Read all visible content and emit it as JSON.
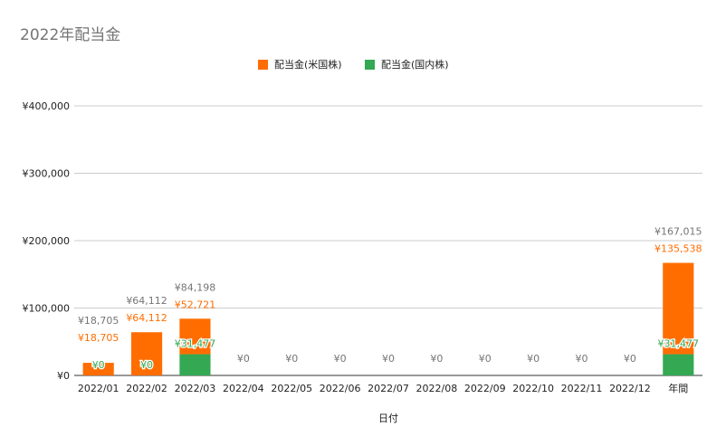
{
  "chart_data": {
    "type": "bar",
    "stacked": true,
    "title": "2022年配当金",
    "xlabel": "日付",
    "ylabel": "",
    "ylim": [
      0,
      400000
    ],
    "yticks": [
      0,
      100000,
      200000,
      300000,
      400000
    ],
    "ytick_labels": [
      "¥0",
      "¥100,000",
      "¥200,000",
      "¥300,000",
      "¥400,000"
    ],
    "grid": true,
    "legend_position": "top-center",
    "categories": [
      "2022/01",
      "2022/02",
      "2022/03",
      "2022/04",
      "2022/05",
      "2022/06",
      "2022/07",
      "2022/08",
      "2022/09",
      "2022/10",
      "2022/11",
      "2022/12",
      "年間"
    ],
    "series": [
      {
        "name": "配当金(国内株)",
        "color": "#34a853",
        "values": [
          0,
          0,
          31477,
          0,
          0,
          0,
          0,
          0,
          0,
          0,
          0,
          0,
          31477
        ],
        "labels": [
          "¥0",
          "¥0",
          "¥31,477",
          "¥0",
          "¥0",
          "¥0",
          "¥0",
          "¥0",
          "¥0",
          "¥0",
          "¥0",
          "¥0",
          "¥31,477"
        ]
      },
      {
        "name": "配当金(米国株)",
        "color": "#ff6d01",
        "values": [
          18705,
          64112,
          52721,
          0,
          0,
          0,
          0,
          0,
          0,
          0,
          0,
          0,
          135538
        ],
        "labels": [
          "¥18,705",
          "¥64,112",
          "¥52,721",
          "",
          "",
          "",
          "",
          "",
          "",
          "",
          "",
          "",
          "¥135,538"
        ]
      }
    ],
    "totals": [
      18705,
      64112,
      84198,
      0,
      0,
      0,
      0,
      0,
      0,
      0,
      0,
      0,
      167015
    ],
    "total_labels": [
      "¥18,705",
      "¥64,112",
      "¥84,198",
      "",
      "",
      "",
      "",
      "",
      "",
      "",
      "",
      "",
      "¥167,015"
    ],
    "legend_order": [
      "配当金(米国株)",
      "配当金(国内株)"
    ]
  }
}
